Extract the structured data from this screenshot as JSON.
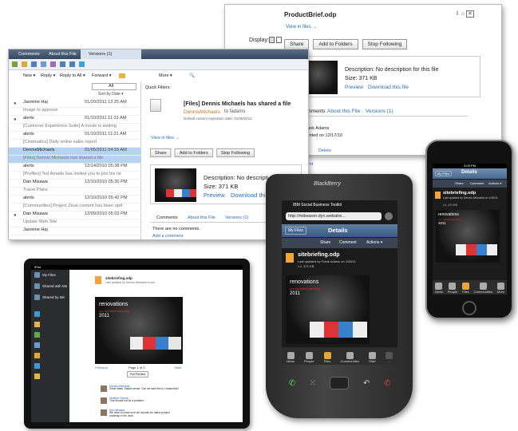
{
  "top": {
    "title": "ProductBrief.odp",
    "view_in_files": "View in files →",
    "display_label": "Display:",
    "buttons": [
      "Share",
      "Add to Folders",
      "Stop Following"
    ],
    "description": "Description: No description for this file",
    "size": "Size: 371 KB",
    "preview": "Preview",
    "download": "Download this file",
    "tabs": [
      "Comments",
      "About this File",
      "Versions (1)"
    ],
    "peek_name": "Frank Adams",
    "peek_line": "mented on 12/17/10",
    "peek_delete": "Delete",
    "peek_reply": "ment"
  },
  "mail": {
    "tabs": [
      "Comments",
      "About this File",
      "Versions (1)"
    ],
    "toolbar": [
      "New ▾",
      "Reply ▾",
      "Reply to All ▾",
      "Forward ▾",
      "More ▾"
    ],
    "filter": "All",
    "sort": "Sort by Date ▾",
    "rows": [
      {
        "from": "Jasmine Haj",
        "date": "01/20/2011 12:25 AM",
        "dot": true
      },
      {
        "from": "Image to approve",
        "date": "",
        "dot": false
      },
      {
        "from": "alerts",
        "date": "01/10/2011 11:31 AM",
        "dot": true
      },
      {
        "from": "[Customer Experience Suite] A movie is waiting",
        "date": "",
        "dot": false
      },
      {
        "from": "alerts",
        "date": "01/10/2011 11:31 AM",
        "dot": false
      },
      {
        "from": "[Cinematics] Daily online sales report",
        "date": "",
        "dot": false
      },
      {
        "from": "DennisMichaels",
        "date": "01/05/2011 04:15 AM",
        "dot": false
      },
      {
        "from": "[Files] Dennis Michaels has shared a file",
        "date": "",
        "dot": false
      },
      {
        "from": "alerts",
        "date": "12/14/2010 05:38 PM",
        "dot": false
      },
      {
        "from": "[Profiles] Ted Amado has invited you to join his ne",
        "date": "",
        "dot": false
      },
      {
        "from": "Dan Misawa",
        "date": "12/10/2010 05:30 PM",
        "dot": false
      },
      {
        "from": "Travel Plans",
        "date": "",
        "dot": false
      },
      {
        "from": "alerts",
        "date": "12/10/2010 05:42 PM",
        "dot": false
      },
      {
        "from": "[Communities] Project Zeus content has been upd",
        "date": "",
        "dot": false
      },
      {
        "from": "Dan Misawa",
        "date": "12/09/2010 05:03 PM",
        "dot": true
      },
      {
        "from": "Update Web Site",
        "date": "",
        "dot": false
      },
      {
        "from": "Jasmine Haj",
        "date": "",
        "dot": false
      }
    ],
    "quick_filters": "Quick Filters:",
    "subject": "[Files] Dennis Michaels has shared a file",
    "sender": "DennisMichaels",
    "to": "to fadams",
    "meta": "Default custom expiration date: 01/05/2012",
    "view_in_files": "View in files →",
    "buttons": [
      "Share",
      "Add to Folders",
      "Stop Following"
    ],
    "description": "Description: No descripti",
    "size": "Size: 371 KB",
    "preview": "Preview",
    "download": "Download this fi",
    "no_comments": "There are no comments.",
    "add_comment": "Add a comment"
  },
  "blackberry": {
    "brand": "BlackBerry",
    "app": "IBM Social Business Toolkit",
    "url": "http://mibeaver.dyn.webahe...",
    "back": "My Files",
    "title": "Details",
    "actions": [
      "Share",
      "Comment",
      "Actions ▾"
    ],
    "file": "sitebriefing.odp",
    "updated": "Last updated by Frank Adams on 1/26/11",
    "version": "v.1, 471 KB",
    "thumb_title": "renovations",
    "thumb_sub": "our updated branding",
    "thumb_year": "2011",
    "tabbar": [
      "News",
      "People",
      "Files",
      "Communities",
      "Start",
      "..."
    ]
  },
  "iphone": {
    "time": "3:05 PM",
    "back": "My Files",
    "title": "Details",
    "actions": [
      "Share",
      "Comment",
      "Actions ▾"
    ],
    "file": "sitebriefing.odp",
    "updated": "Last updated by Dennis Michaels on 1/26/11",
    "version": "v.1, 471 KB",
    "thumb_title": "renovations",
    "thumb_sub": "our updated branding",
    "thumb_year": "2011",
    "tabbar": [
      "News",
      "People",
      "Files",
      "Communities",
      "More"
    ]
  },
  "ipad": {
    "status": "iPad",
    "sidebar": [
      "My Files",
      "Shared with Me",
      "Shared by Me"
    ],
    "file": "sitebriefing.odp",
    "shared_by": "Last updated by Dennis Michaels to you",
    "thumb_title": "renovations",
    "thumb_sub": "our updated branding",
    "thumb_year": "2011",
    "prev": "Previous",
    "page": "Page 1 of 3",
    "next": "Next",
    "full_preview": "Full Preview",
    "comments": [
      {
        "name": "Dennis Michaels",
        "text": "Great ideas, Makes sense. Can we take this to Leadership?"
      },
      {
        "name": "Heather Reeds",
        "text": "That should not be a problem."
      },
      {
        "name": "Dan Misawa",
        "text": "We have to make sure we include our latest product roadmap in the deck."
      }
    ]
  }
}
